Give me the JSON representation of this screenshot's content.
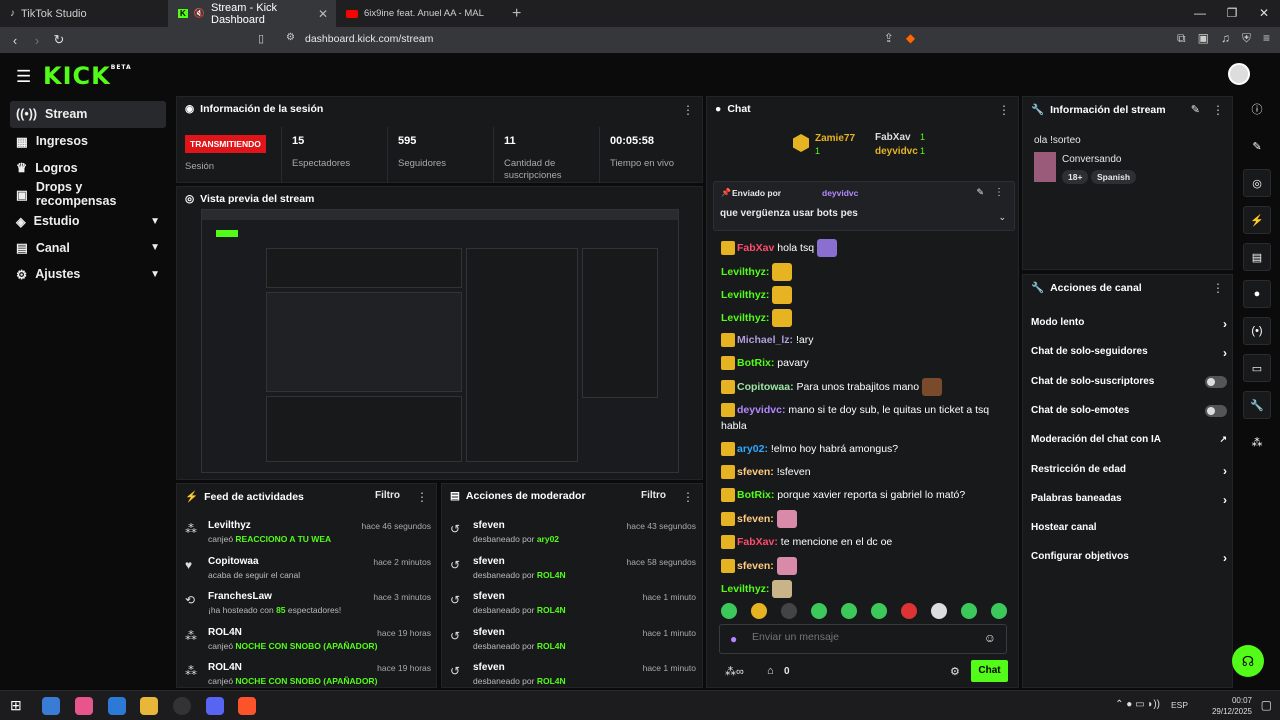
{
  "browser": {
    "tabs": [
      {
        "label": "TikTok Studio"
      },
      {
        "label": "Stream - Kick Dashboard"
      },
      {
        "label": "6ix9ine feat. Anuel AA - MALA (L..."
      }
    ],
    "url": "dashboard.kick.com/stream"
  },
  "app": {
    "logo": "KICK",
    "logo_sup": "BETA"
  },
  "sidebar": {
    "items": [
      {
        "label": "Stream",
        "icon": "broadcast-icon"
      },
      {
        "label": "Ingresos",
        "icon": "money-icon"
      },
      {
        "label": "Logros",
        "icon": "trophy-icon"
      },
      {
        "label": "Drops y recompensas",
        "icon": "gift-icon"
      },
      {
        "label": "Estudio",
        "icon": "studio-icon"
      },
      {
        "label": "Canal",
        "icon": "channel-icon"
      },
      {
        "label": "Ajustes",
        "icon": "gear-icon"
      }
    ]
  },
  "session": {
    "title": "Información de la sesión",
    "live_label": "TRANSMITIENDO",
    "session_label": "Sesión",
    "stats": [
      {
        "value": "15",
        "label": "Espectadores"
      },
      {
        "value": "595",
        "label": "Seguidores"
      },
      {
        "value": "11",
        "label": "Cantidad de suscripciones"
      },
      {
        "value": "00:05:58",
        "label": "Tiempo en vivo"
      }
    ]
  },
  "preview": {
    "title": "Vista previa del stream"
  },
  "feed": {
    "title": "Feed de actividades",
    "filter": "Filtro",
    "rows": [
      {
        "name": "Levilthyz",
        "time": "hace 46 segundos",
        "pre": "canjeó ",
        "hl": "REACCIONO A TU WEA",
        "post": ""
      },
      {
        "name": "Copitowaa",
        "time": "hace 2 minutos",
        "pre": "acaba de seguir el canal",
        "hl": "",
        "post": ""
      },
      {
        "name": "FranchesLaw",
        "time": "hace 3 minutos",
        "pre": "¡ha hosteado con ",
        "hl": "85",
        "post": " espectadores!"
      },
      {
        "name": "ROL4N",
        "time": "hace 19 horas",
        "pre": "canjeó ",
        "hl": "NOCHE CON SNOBO (APAÑADOR)",
        "post": ""
      },
      {
        "name": "ROL4N",
        "time": "hace 19 horas",
        "pre": "canjeó ",
        "hl": "NOCHE CON SNOBO (APAÑADOR)",
        "post": ""
      }
    ]
  },
  "mod": {
    "title": "Acciones de moderador",
    "filter": "Filtro",
    "rows": [
      {
        "name": "sfeven",
        "time": "hace 43 segundos",
        "pre": "desbaneado por ",
        "hl": "ary02"
      },
      {
        "name": "sfeven",
        "time": "hace 58 segundos",
        "pre": "desbaneado por ",
        "hl": "ROL4N"
      },
      {
        "name": "sfeven",
        "time": "hace 1 minuto",
        "pre": "desbaneado por ",
        "hl": "ROL4N"
      },
      {
        "name": "sfeven",
        "time": "hace 1 minuto",
        "pre": "desbaneado por ",
        "hl": "ROL4N"
      },
      {
        "name": "sfeven",
        "time": "hace 1 minuto",
        "pre": "desbaneado por ",
        "hl": "ROL4N"
      }
    ]
  },
  "chat": {
    "title": "Chat",
    "leaderboard": [
      {
        "name": "Zamie77",
        "count": "1"
      },
      {
        "name": "FabXav",
        "count": "1"
      },
      {
        "name": "deyvidvc",
        "count": "1"
      }
    ],
    "pinned_by_label": "Enviado por",
    "pinned_user": "deyvidvc",
    "pinned_text": "que vergüenza usar bots pes",
    "messages": [
      {
        "user": "FabXav",
        "color": "#ff4d6d",
        "text": "hola tsq",
        "emote": true
      },
      {
        "user": "Levilthyz:",
        "color": "#53fc18",
        "text": "",
        "emote": true
      },
      {
        "user": "Levilthyz:",
        "color": "#53fc18",
        "text": "",
        "emote": true
      },
      {
        "user": "Levilthyz:",
        "color": "#53fc18",
        "text": "",
        "emote": true
      },
      {
        "user": "Michael_lz:",
        "color": "#b39ddb",
        "text": "!ary",
        "emote": false
      },
      {
        "user": "BotRix:",
        "color": "#53fc18",
        "text": "pavary",
        "emote": false
      },
      {
        "user": "Copitowaa:",
        "color": "#9fe3a5",
        "text": "Para unos trabajitos mano",
        "emote": true
      },
      {
        "user": "deyvidvc:",
        "color": "#b388ff",
        "text": "mano si te doy sub, le quitas un ticket a tsq habla",
        "emote": false
      },
      {
        "user": "ary02:",
        "color": "#2fa8ff",
        "text": "!elmo hoy habrá amongus?",
        "emote": false
      },
      {
        "user": "sfeven:",
        "color": "#ffcc80",
        "text": "!sfeven",
        "emote": false
      },
      {
        "user": "BotRix:",
        "color": "#53fc18",
        "text": "porque xavier reporta si gabriel lo mató?",
        "emote": false
      },
      {
        "user": "sfeven:",
        "color": "#ffcc80",
        "text": "",
        "emote": true
      },
      {
        "user": "FabXav:",
        "color": "#ff4d6d",
        "text": "te mencione en el dc oe",
        "emote": false
      },
      {
        "user": "sfeven:",
        "color": "#ffcc80",
        "text": "",
        "emote": true
      },
      {
        "user": "Levilthyz:",
        "color": "#53fc18",
        "text": "",
        "emote": true
      }
    ],
    "input_placeholder": "Enviar un mensaje",
    "points": "0",
    "send_label": "Chat"
  },
  "stream_info": {
    "title": "Información del stream",
    "stream_title": "ola !sorteo",
    "category": "Conversando",
    "tags": [
      "18+",
      "Spanish"
    ]
  },
  "channel_actions": {
    "title": "Acciones de canal",
    "items": [
      {
        "label": "Modo lento",
        "control": "chevron"
      },
      {
        "label": "Chat de solo-seguidores",
        "control": "chevron"
      },
      {
        "label": "Chat de solo-suscriptores",
        "control": "toggle"
      },
      {
        "label": "Chat de solo-emotes",
        "control": "toggle"
      },
      {
        "label": "Moderación del chat con IA",
        "control": "external"
      },
      {
        "label": "Restricción de edad",
        "control": "chevron"
      },
      {
        "label": "Palabras baneadas",
        "control": "chevron"
      },
      {
        "label": "Hostear canal",
        "control": "none"
      },
      {
        "label": "Configurar objetivos",
        "control": "chevron"
      }
    ]
  },
  "taskbar": {
    "lang": "ESP",
    "time": "00:07",
    "date": "29/12/2025"
  },
  "colors": {
    "accent": "#53fc18",
    "live": "#e0151a",
    "panel": "#18191b"
  }
}
